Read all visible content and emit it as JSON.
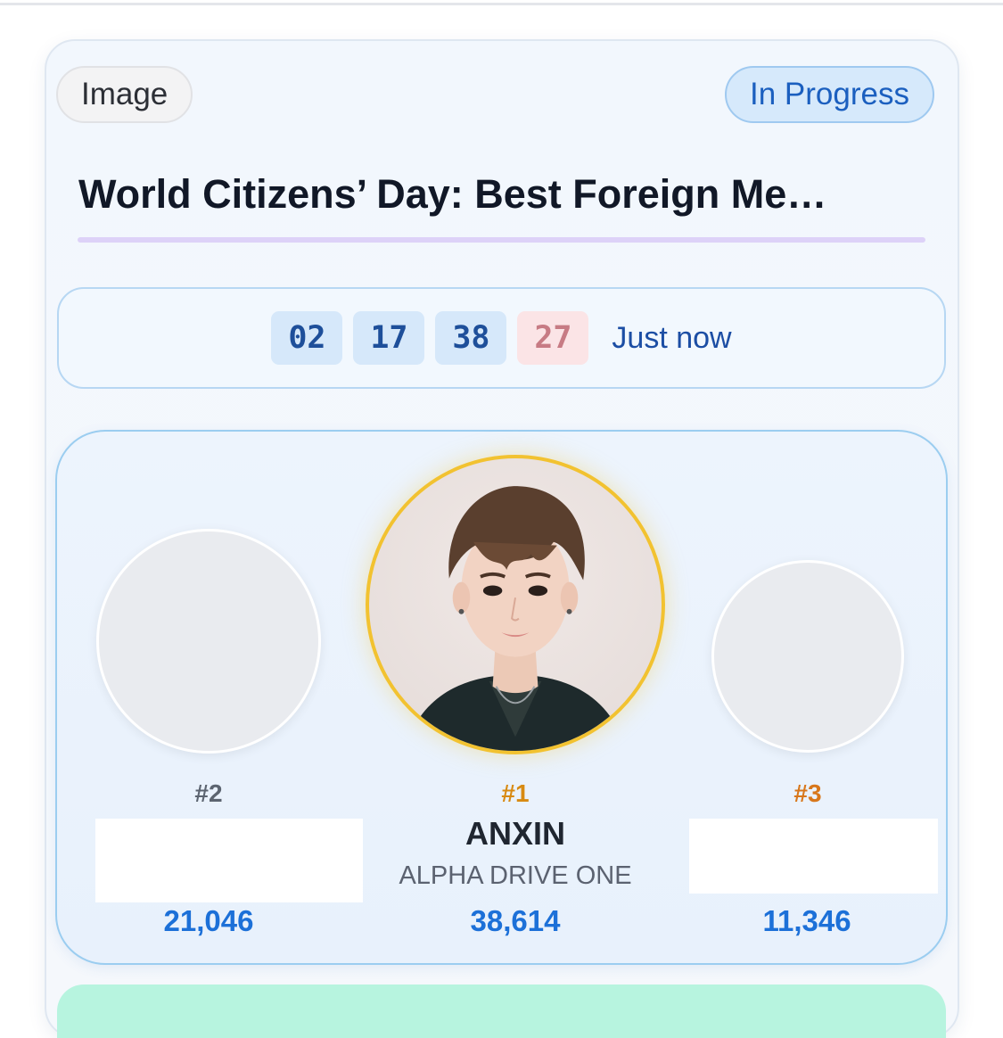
{
  "header": {
    "type_label": "Image",
    "status_label": "In Progress",
    "title": "World Citizens’ Day: Best Foreign Me…"
  },
  "countdown": {
    "days": "02",
    "hours": "17",
    "minutes": "38",
    "seconds": "27",
    "updated_text": "Just now"
  },
  "podium": {
    "second": {
      "rank": "#2",
      "votes": "21,046"
    },
    "first": {
      "rank": "#1",
      "name": "ANXIN",
      "group": "ALPHA DRIVE ONE",
      "votes": "38,614"
    },
    "third": {
      "rank": "#3",
      "votes": "11,346"
    }
  },
  "colors": {
    "accent_blue": "#1c70d8",
    "gold": "#f2c230",
    "status_blue": "#1b5fbf"
  }
}
